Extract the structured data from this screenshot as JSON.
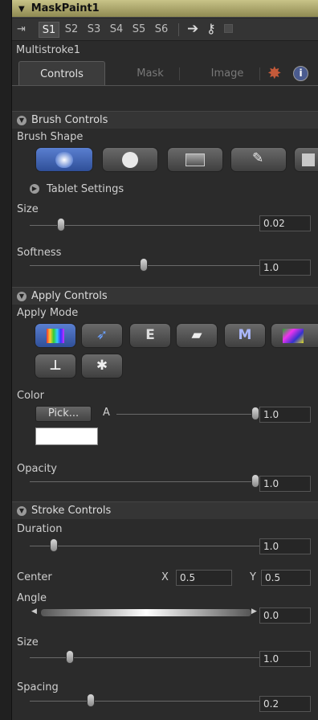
{
  "header": {
    "title": "MaskPaint1"
  },
  "stroke_bar": {
    "strokes": [
      "S1",
      "S2",
      "S3",
      "S4",
      "S5",
      "S6"
    ],
    "selected": "S1"
  },
  "node_name": "Multistroke1",
  "tabs": {
    "controls": "Controls",
    "mask": "Mask",
    "image": "Image"
  },
  "brush_controls": {
    "title": "Brush Controls",
    "brush_shape_label": "Brush Shape",
    "tablet_settings_label": "Tablet Settings",
    "size_label": "Size",
    "size_value": "0.02",
    "softness_label": "Softness",
    "softness_value": "1.0"
  },
  "apply_controls": {
    "title": "Apply Controls",
    "apply_mode_label": "Apply Mode",
    "mode_e": "E",
    "mode_m": "M",
    "color_label": "Color",
    "pick_button": "Pick...",
    "alpha_label": "A",
    "alpha_value": "1.0",
    "opacity_label": "Opacity",
    "opacity_value": "1.0"
  },
  "stroke_controls": {
    "title": "Stroke Controls",
    "duration_label": "Duration",
    "duration_value": "1.0",
    "center_label": "Center",
    "x_label": "X",
    "x_value": "0.5",
    "y_label": "Y",
    "y_value": "0.5",
    "angle_label": "Angle",
    "angle_value": "0.0",
    "size_label": "Size",
    "size_value": "1.0",
    "spacing_label": "Spacing",
    "spacing_value": "0.2"
  },
  "sliders": {
    "brush_size": 0.12,
    "softness": 0.48,
    "alpha": 1.0,
    "opacity": 1.0,
    "duration": 0.02,
    "stroke_size": 0.1,
    "spacing": 0.2
  },
  "colors": {
    "accent": "#3b5fb5",
    "header": "#b9b47a",
    "swatch": "#ffffff"
  }
}
